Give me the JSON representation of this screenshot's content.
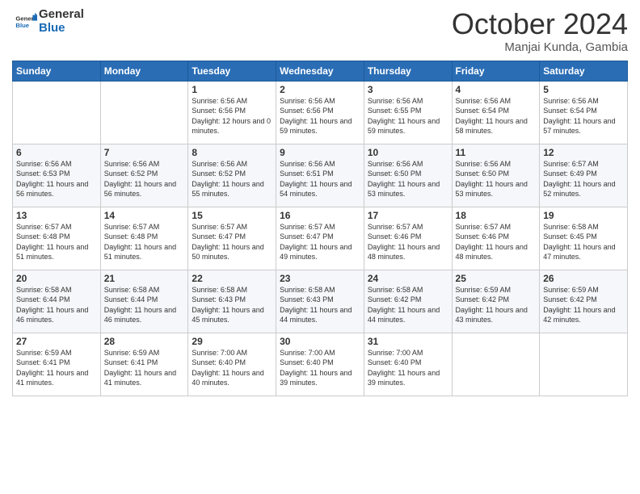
{
  "header": {
    "logo_general": "General",
    "logo_blue": "Blue",
    "month": "October 2024",
    "location": "Manjai Kunda, Gambia"
  },
  "days_of_week": [
    "Sunday",
    "Monday",
    "Tuesday",
    "Wednesday",
    "Thursday",
    "Friday",
    "Saturday"
  ],
  "weeks": [
    [
      {
        "day": "",
        "info": ""
      },
      {
        "day": "",
        "info": ""
      },
      {
        "day": "1",
        "sunrise": "6:56 AM",
        "sunset": "6:56 PM",
        "daylight": "12 hours and 0 minutes."
      },
      {
        "day": "2",
        "sunrise": "6:56 AM",
        "sunset": "6:56 PM",
        "daylight": "11 hours and 59 minutes."
      },
      {
        "day": "3",
        "sunrise": "6:56 AM",
        "sunset": "6:55 PM",
        "daylight": "11 hours and 59 minutes."
      },
      {
        "day": "4",
        "sunrise": "6:56 AM",
        "sunset": "6:54 PM",
        "daylight": "11 hours and 58 minutes."
      },
      {
        "day": "5",
        "sunrise": "6:56 AM",
        "sunset": "6:54 PM",
        "daylight": "11 hours and 57 minutes."
      }
    ],
    [
      {
        "day": "6",
        "sunrise": "6:56 AM",
        "sunset": "6:53 PM",
        "daylight": "11 hours and 56 minutes."
      },
      {
        "day": "7",
        "sunrise": "6:56 AM",
        "sunset": "6:52 PM",
        "daylight": "11 hours and 56 minutes."
      },
      {
        "day": "8",
        "sunrise": "6:56 AM",
        "sunset": "6:52 PM",
        "daylight": "11 hours and 55 minutes."
      },
      {
        "day": "9",
        "sunrise": "6:56 AM",
        "sunset": "6:51 PM",
        "daylight": "11 hours and 54 minutes."
      },
      {
        "day": "10",
        "sunrise": "6:56 AM",
        "sunset": "6:50 PM",
        "daylight": "11 hours and 53 minutes."
      },
      {
        "day": "11",
        "sunrise": "6:56 AM",
        "sunset": "6:50 PM",
        "daylight": "11 hours and 53 minutes."
      },
      {
        "day": "12",
        "sunrise": "6:57 AM",
        "sunset": "6:49 PM",
        "daylight": "11 hours and 52 minutes."
      }
    ],
    [
      {
        "day": "13",
        "sunrise": "6:57 AM",
        "sunset": "6:48 PM",
        "daylight": "11 hours and 51 minutes."
      },
      {
        "day": "14",
        "sunrise": "6:57 AM",
        "sunset": "6:48 PM",
        "daylight": "11 hours and 51 minutes."
      },
      {
        "day": "15",
        "sunrise": "6:57 AM",
        "sunset": "6:47 PM",
        "daylight": "11 hours and 50 minutes."
      },
      {
        "day": "16",
        "sunrise": "6:57 AM",
        "sunset": "6:47 PM",
        "daylight": "11 hours and 49 minutes."
      },
      {
        "day": "17",
        "sunrise": "6:57 AM",
        "sunset": "6:46 PM",
        "daylight": "11 hours and 48 minutes."
      },
      {
        "day": "18",
        "sunrise": "6:57 AM",
        "sunset": "6:46 PM",
        "daylight": "11 hours and 48 minutes."
      },
      {
        "day": "19",
        "sunrise": "6:58 AM",
        "sunset": "6:45 PM",
        "daylight": "11 hours and 47 minutes."
      }
    ],
    [
      {
        "day": "20",
        "sunrise": "6:58 AM",
        "sunset": "6:44 PM",
        "daylight": "11 hours and 46 minutes."
      },
      {
        "day": "21",
        "sunrise": "6:58 AM",
        "sunset": "6:44 PM",
        "daylight": "11 hours and 46 minutes."
      },
      {
        "day": "22",
        "sunrise": "6:58 AM",
        "sunset": "6:43 PM",
        "daylight": "11 hours and 45 minutes."
      },
      {
        "day": "23",
        "sunrise": "6:58 AM",
        "sunset": "6:43 PM",
        "daylight": "11 hours and 44 minutes."
      },
      {
        "day": "24",
        "sunrise": "6:58 AM",
        "sunset": "6:42 PM",
        "daylight": "11 hours and 44 minutes."
      },
      {
        "day": "25",
        "sunrise": "6:59 AM",
        "sunset": "6:42 PM",
        "daylight": "11 hours and 43 minutes."
      },
      {
        "day": "26",
        "sunrise": "6:59 AM",
        "sunset": "6:42 PM",
        "daylight": "11 hours and 42 minutes."
      }
    ],
    [
      {
        "day": "27",
        "sunrise": "6:59 AM",
        "sunset": "6:41 PM",
        "daylight": "11 hours and 41 minutes."
      },
      {
        "day": "28",
        "sunrise": "6:59 AM",
        "sunset": "6:41 PM",
        "daylight": "11 hours and 41 minutes."
      },
      {
        "day": "29",
        "sunrise": "7:00 AM",
        "sunset": "6:40 PM",
        "daylight": "11 hours and 40 minutes."
      },
      {
        "day": "30",
        "sunrise": "7:00 AM",
        "sunset": "6:40 PM",
        "daylight": "11 hours and 39 minutes."
      },
      {
        "day": "31",
        "sunrise": "7:00 AM",
        "sunset": "6:40 PM",
        "daylight": "11 hours and 39 minutes."
      },
      {
        "day": "",
        "info": ""
      },
      {
        "day": "",
        "info": ""
      }
    ]
  ],
  "labels": {
    "sunrise": "Sunrise:",
    "sunset": "Sunset:",
    "daylight": "Daylight:"
  }
}
